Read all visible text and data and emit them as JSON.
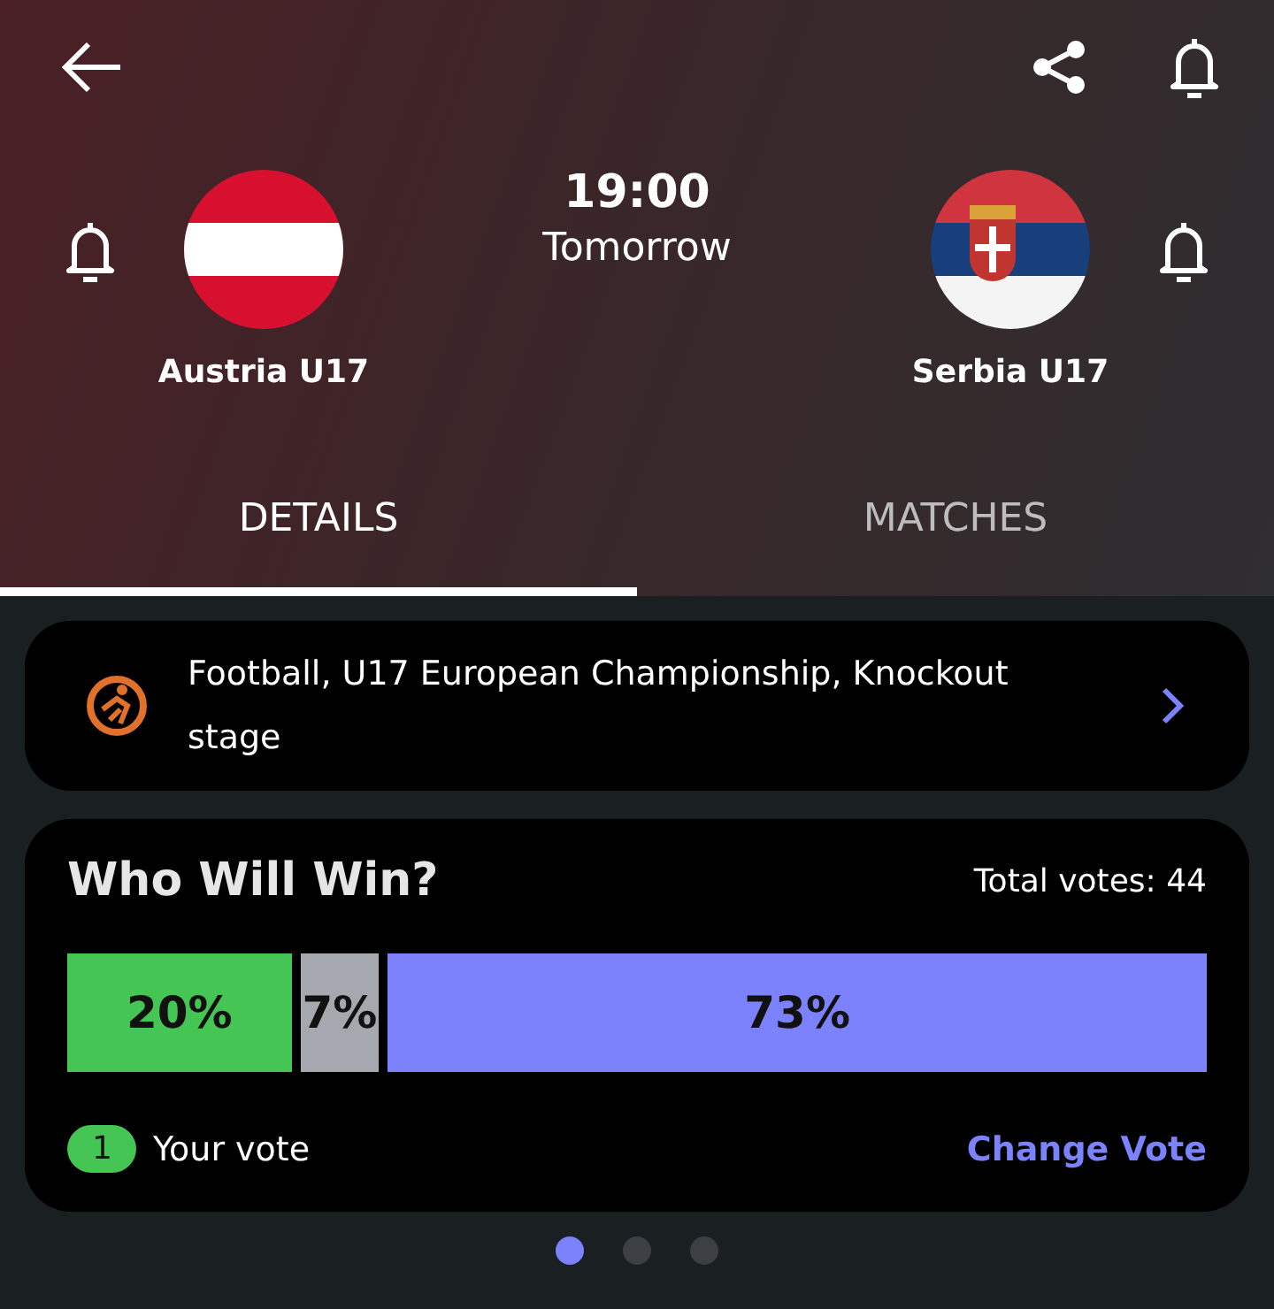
{
  "match": {
    "time": "19:00",
    "day": "Tomorrow"
  },
  "teams": [
    {
      "name": "Austria U17"
    },
    {
      "name": "Serbia U17"
    }
  ],
  "tabs": [
    {
      "label": "DETAILS",
      "selected": true
    },
    {
      "label": "MATCHES",
      "selected": false
    }
  ],
  "competition": {
    "text": "Football, U17 European Championship, Knockout stage"
  },
  "poll": {
    "title": "Who Will Win?",
    "total_votes": "Total votes: 44",
    "segments": [
      {
        "label": "20%",
        "color": "#44c554"
      },
      {
        "label": "7%",
        "color": "#a5a8ae"
      },
      {
        "label": "73%",
        "color": "#7b82fb"
      }
    ],
    "your_vote_badge": "1",
    "your_vote_label": "Your vote",
    "change_vote": "Change Vote"
  },
  "pager": [
    {
      "selected": true
    },
    {
      "selected": false
    },
    {
      "selected": false
    }
  ]
}
